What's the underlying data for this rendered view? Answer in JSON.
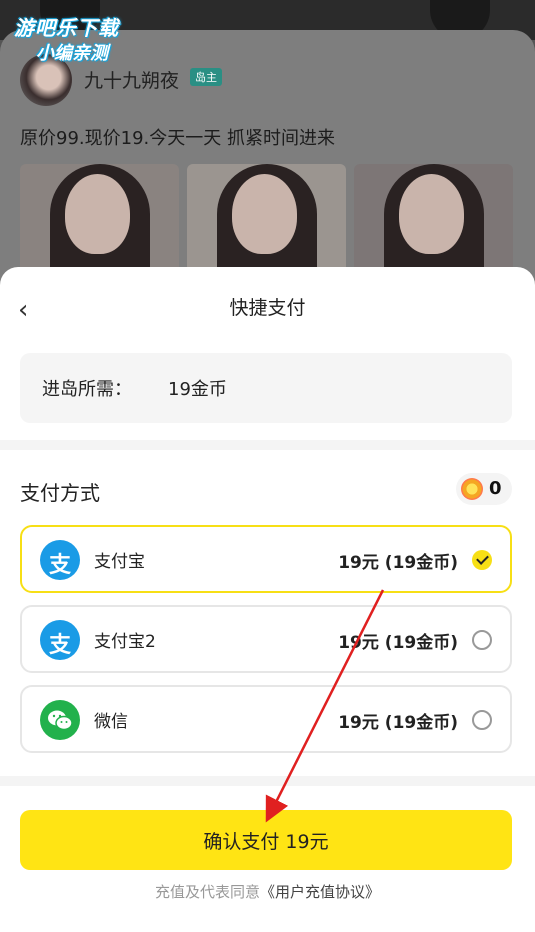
{
  "watermark": {
    "line1": "游吧乐下载",
    "line2": "小编亲测"
  },
  "post": {
    "author": "九十九朔夜",
    "badge": "岛主",
    "text": "原价99.现价19.今天一天 抓紧时间进来"
  },
  "sheet": {
    "title": "快捷支付",
    "requirement_label": "进岛所需：",
    "requirement_value": "19金币",
    "payment_method_title": "支付方式",
    "coin_balance": "0",
    "options": [
      {
        "name": "支付宝",
        "price": "19元 (19金币)",
        "icon": "alipay-icon",
        "selected": true
      },
      {
        "name": "支付宝2",
        "price": "19元 (19金币)",
        "icon": "alipay-icon",
        "selected": false
      },
      {
        "name": "微信",
        "price": "19元 (19金币)",
        "icon": "wechat-icon",
        "selected": false
      }
    ],
    "confirm_label": "确认支付 19元",
    "agreement_prefix": "充值及代表同意",
    "agreement_link": "《用户充值协议》"
  },
  "colors": {
    "accent": "#ffe414",
    "alipay": "#1a9be6",
    "wechat": "#22b14c",
    "annotation_arrow": "#e02020"
  }
}
